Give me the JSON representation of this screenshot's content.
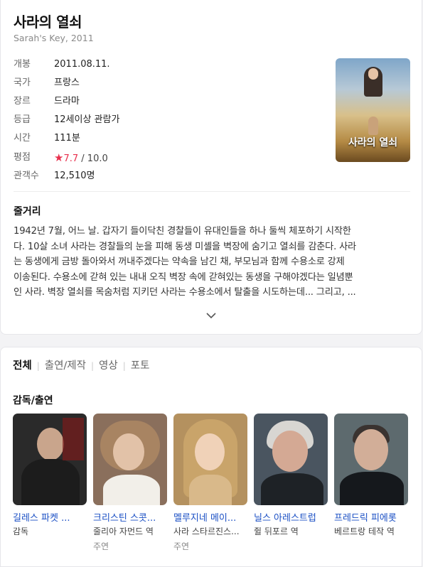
{
  "movie": {
    "title": "사라의 열쇠",
    "subtitle": "Sarah's Key, 2011",
    "info": [
      {
        "label": "개봉",
        "value": "2011.08.11."
      },
      {
        "label": "국가",
        "value": "프랑스"
      },
      {
        "label": "장르",
        "value": "드라마"
      },
      {
        "label": "등급",
        "value": "12세이상 관람가"
      },
      {
        "label": "시간",
        "value": "111분"
      },
      {
        "label": "평점",
        "value": ""
      },
      {
        "label": "관객수",
        "value": "12,510명"
      }
    ],
    "rating": {
      "star": "★",
      "score": "7.7",
      "max": "/ 10.0"
    },
    "poster_text": "사라의 열쇠"
  },
  "synopsis": {
    "heading": "줄거리",
    "lines": [
      "1942년 7월, 어느 날. 갑자기 들이닥친 경찰들이 유대인들을 하나 둘씩 체포하기 시작한",
      "다. 10살 소녀 사라는 경찰들의 눈을 피해 동생 미셸을 벽장에 숨기고 열쇠를 감춘다. 사라",
      "는 동생에게 금방 돌아와서 꺼내주겠다는 약속을 남긴 채, 부모님과 함께 수용소로 강제",
      "이송된다. 수용소에 갇혀 있는 내내 오직 벽장 속에 갇혀있는 동생을 구해야겠다는 일념뿐",
      "인 사라. 벽장 열쇠를 목숨처럼 지키던 사라는 수용소에서 탈출을 시도하는데... 그리고, ..."
    ],
    "expand_icon": "chevron-down-icon"
  },
  "tabs": {
    "items": [
      "전체",
      "출연/제작",
      "영상",
      "포토"
    ],
    "separator": "|",
    "active": 0
  },
  "cast": {
    "heading": "감독/출연",
    "people": [
      {
        "name": "길레스 파켓 ...",
        "role": "감독",
        "type": "",
        "photo_bg": "#2a2a2a"
      },
      {
        "name": "크리스틴 스콧...",
        "role": "줄리아 자먼드 역",
        "type": "주연",
        "photo_bg": "#8a6f5c"
      },
      {
        "name": "멜루지네 메이...",
        "role": "사라 스타르진스...",
        "type": "주연",
        "photo_bg": "#b4915f"
      },
      {
        "name": "닐스 아레스트럽",
        "role": "쥘 뒤포르 역",
        "type": "",
        "photo_bg": "#4a5560"
      },
      {
        "name": "프레드릭 피에롯",
        "role": "베르트랑 테작 역",
        "type": "",
        "photo_bg": "#5d6a6e"
      }
    ]
  },
  "colors": {
    "accent_red": "#e8304d",
    "link_blue": "#1a4fc4"
  }
}
